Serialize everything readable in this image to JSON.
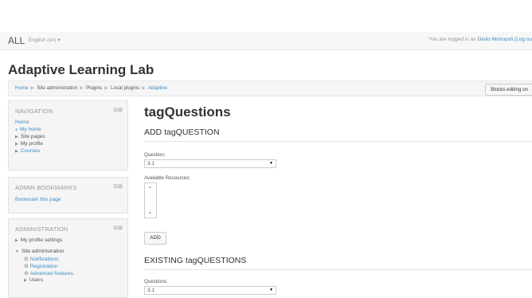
{
  "topbar": {
    "brand": "ALL",
    "language": "English (en) ▾",
    "login_prefix": "You are logged in as ",
    "user": "Giulio Monopoli",
    "logout": " (Log ou"
  },
  "site": {
    "title": "Adaptive Learning Lab"
  },
  "breadcrumb": {
    "items": [
      "Home",
      "Site administration",
      "Plugins",
      "Local plugins",
      "Adaptive"
    ],
    "separator": "▶"
  },
  "blocks_editing_button": "Blocks editing on",
  "navigation": {
    "title": "NAVIGATION",
    "home": "Home",
    "items": [
      "My home",
      "Site pages",
      "My profile",
      "Courses"
    ]
  },
  "admin_bookmarks": {
    "title": "ADMIN BOOKMARKS",
    "link": "Bookmark this page"
  },
  "administration": {
    "title": "ADMINISTRATION",
    "my_profile_settings": "My profile settings",
    "site_admin": "Site administration",
    "sub_items": [
      "Notifications",
      "Registration",
      "Advanced features"
    ],
    "users": "Users"
  },
  "block_controls": "⊟⊞",
  "main": {
    "page_title": "tagQuestions",
    "add_heading": "ADD tagQUESTION",
    "question_label": "Question:",
    "question_value": "3.1",
    "resources_label": "Available Resources:",
    "add_button": "ADD",
    "existing_heading": "EXISTING tagQUESTIONS",
    "questions_label": "Questions:",
    "questions_value": "3.1"
  },
  "colors": {
    "link": "#3b8dc8",
    "block_bg": "#f5f5f5"
  },
  "icons": [
    "gear-icon",
    "arrow-right-icon",
    "arrow-down-icon",
    "dropdown-caret-icon"
  ]
}
